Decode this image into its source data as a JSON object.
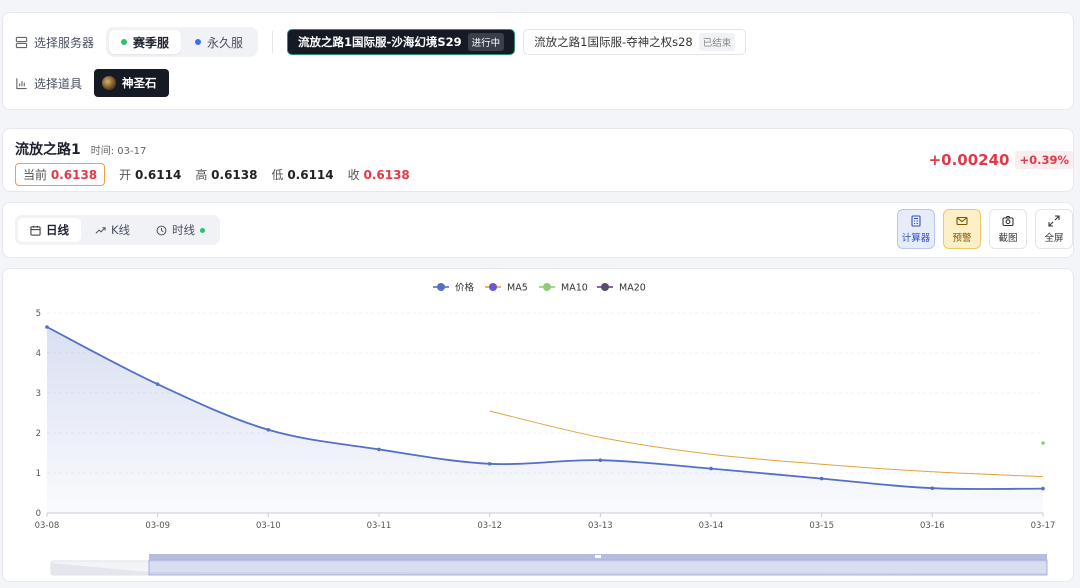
{
  "server_selector": {
    "label": "选择服务器",
    "modes": [
      {
        "label": "赛季服",
        "active": true,
        "dot_color": "#2fbf71"
      },
      {
        "label": "永久服",
        "active": false,
        "dot_color": "#3e6ef2"
      }
    ],
    "servers": [
      {
        "name": "流放之路1国际服-沙海幻境S29",
        "status": "进行中",
        "active": true
      },
      {
        "name": "流放之路1国际服-夺神之权s28",
        "status": "已结束",
        "active": false
      }
    ]
  },
  "item_selector": {
    "label": "选择道具",
    "item": "神圣石",
    "icon": "divine-orb-icon"
  },
  "price_panel": {
    "game": "流放之路1",
    "time": "时间: 03-17",
    "current_label": "当前",
    "current": "0.6138",
    "open_label": "开",
    "open": "0.6114",
    "high_label": "高",
    "high": "0.6138",
    "low_label": "低",
    "low": "0.6114",
    "close_label": "收",
    "close": "0.6138",
    "change": "+0.00240",
    "change_pct": "+0.39%"
  },
  "toolbar": {
    "tabs": [
      {
        "label": "日线",
        "icon": "calendar-icon",
        "active": true
      },
      {
        "label": "K线",
        "icon": "trend-icon",
        "active": false
      },
      {
        "label": "时线",
        "icon": "clock-icon",
        "active": false
      }
    ],
    "tools": [
      {
        "label": "计算器",
        "icon": "calculator-icon"
      },
      {
        "label": "预警",
        "icon": "mail-icon"
      },
      {
        "label": "截图",
        "icon": "camera-icon"
      },
      {
        "label": "全屏",
        "icon": "expand-icon"
      }
    ]
  },
  "chart_data": {
    "type": "line",
    "x": [
      "03-08",
      "03-09",
      "03-10",
      "03-11",
      "03-12",
      "03-13",
      "03-14",
      "03-15",
      "03-16",
      "03-17"
    ],
    "ylim": [
      0,
      5
    ],
    "yticks": [
      0,
      1,
      2,
      3,
      4,
      5
    ],
    "legend_position": "top-center",
    "series": [
      {
        "name": "价格",
        "color": "#5470c6",
        "values": [
          4.65,
          3.22,
          2.08,
          1.59,
          1.23,
          1.32,
          1.11,
          0.86,
          0.62,
          0.61
        ]
      },
      {
        "name": "MA5",
        "color": "#e0a43a",
        "values": [
          null,
          null,
          null,
          null,
          2.55,
          1.89,
          1.47,
          1.22,
          1.03,
          0.91
        ]
      },
      {
        "name": "MA10",
        "color": "#91cc75",
        "values": [
          null,
          null,
          null,
          null,
          null,
          null,
          null,
          null,
          null,
          1.75
        ]
      },
      {
        "name": "MA20",
        "color": "#6a3d9a",
        "values": [
          null,
          null,
          null,
          null,
          null,
          null,
          null,
          null,
          null,
          null
        ]
      }
    ]
  }
}
